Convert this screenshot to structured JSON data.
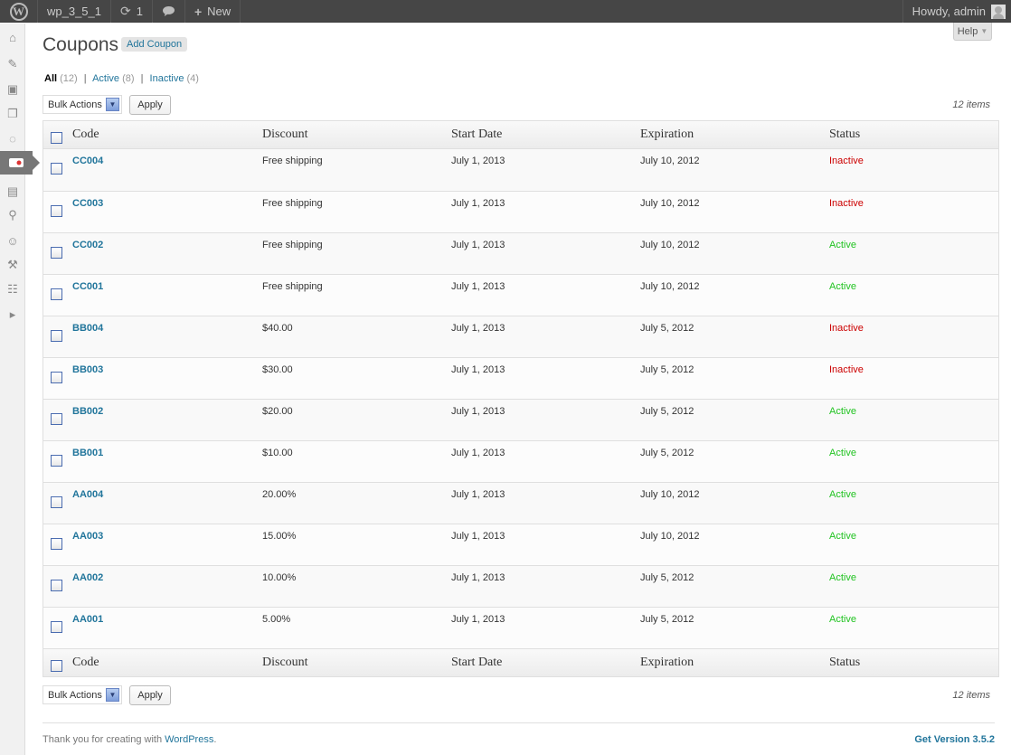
{
  "adminbar": {
    "site_name": "wp_3_5_1",
    "updates_count": "1",
    "new_label": "New",
    "greeting": "Howdy, admin"
  },
  "page": {
    "title": "Coupons",
    "add_button": "Add Coupon",
    "help_label": "Help"
  },
  "filters": {
    "all_label": "All",
    "all_count": "(12)",
    "active_label": "Active",
    "active_count": "(8)",
    "inactive_label": "Inactive",
    "inactive_count": "(4)",
    "separator": "|"
  },
  "bulk": {
    "select_label": "Bulk Actions",
    "apply_label": "Apply",
    "items_count": "12 items"
  },
  "table": {
    "columns": [
      "Code",
      "Discount",
      "Start Date",
      "Expiration",
      "Status"
    ],
    "rows": [
      {
        "code": "CC004",
        "discount": "Free shipping",
        "start": "July 1, 2013",
        "expiration": "July 10, 2012",
        "status": "Inactive"
      },
      {
        "code": "CC003",
        "discount": "Free shipping",
        "start": "July 1, 2013",
        "expiration": "July 10, 2012",
        "status": "Inactive"
      },
      {
        "code": "CC002",
        "discount": "Free shipping",
        "start": "July 1, 2013",
        "expiration": "July 10, 2012",
        "status": "Active"
      },
      {
        "code": "CC001",
        "discount": "Free shipping",
        "start": "July 1, 2013",
        "expiration": "July 10, 2012",
        "status": "Active"
      },
      {
        "code": "BB004",
        "discount": "$40.00",
        "start": "July 1, 2013",
        "expiration": "July 5, 2012",
        "status": "Inactive"
      },
      {
        "code": "BB003",
        "discount": "$30.00",
        "start": "July 1, 2013",
        "expiration": "July 5, 2012",
        "status": "Inactive"
      },
      {
        "code": "BB002",
        "discount": "$20.00",
        "start": "July 1, 2013",
        "expiration": "July 5, 2012",
        "status": "Active"
      },
      {
        "code": "BB001",
        "discount": "$10.00",
        "start": "July 1, 2013",
        "expiration": "July 5, 2012",
        "status": "Active"
      },
      {
        "code": "AA004",
        "discount": "20.00%",
        "start": "July 1, 2013",
        "expiration": "July 10, 2012",
        "status": "Active"
      },
      {
        "code": "AA003",
        "discount": "15.00%",
        "start": "July 1, 2013",
        "expiration": "July 10, 2012",
        "status": "Active"
      },
      {
        "code": "AA002",
        "discount": "10.00%",
        "start": "July 1, 2013",
        "expiration": "July 5, 2012",
        "status": "Active"
      },
      {
        "code": "AA001",
        "discount": "5.00%",
        "start": "July 1, 2013",
        "expiration": "July 5, 2012",
        "status": "Active"
      }
    ]
  },
  "footer": {
    "thanks_prefix": "Thank you for creating with ",
    "wordpress_link": "WordPress",
    "thanks_suffix": ".",
    "version_link": "Get Version 3.5.2"
  },
  "colors": {
    "link": "#21759b",
    "inactive": "#cc0000",
    "active": "#21c321",
    "adminbar": "#464646"
  },
  "icons": {
    "sidebar": [
      "dashboard-icon",
      "posts-icon",
      "media-icon",
      "pages-icon",
      "comments-icon",
      "coupons-icon",
      "appearance-icon",
      "plugins-icon",
      "users-icon",
      "tools-icon",
      "settings-icon",
      "collapse-icon"
    ]
  }
}
